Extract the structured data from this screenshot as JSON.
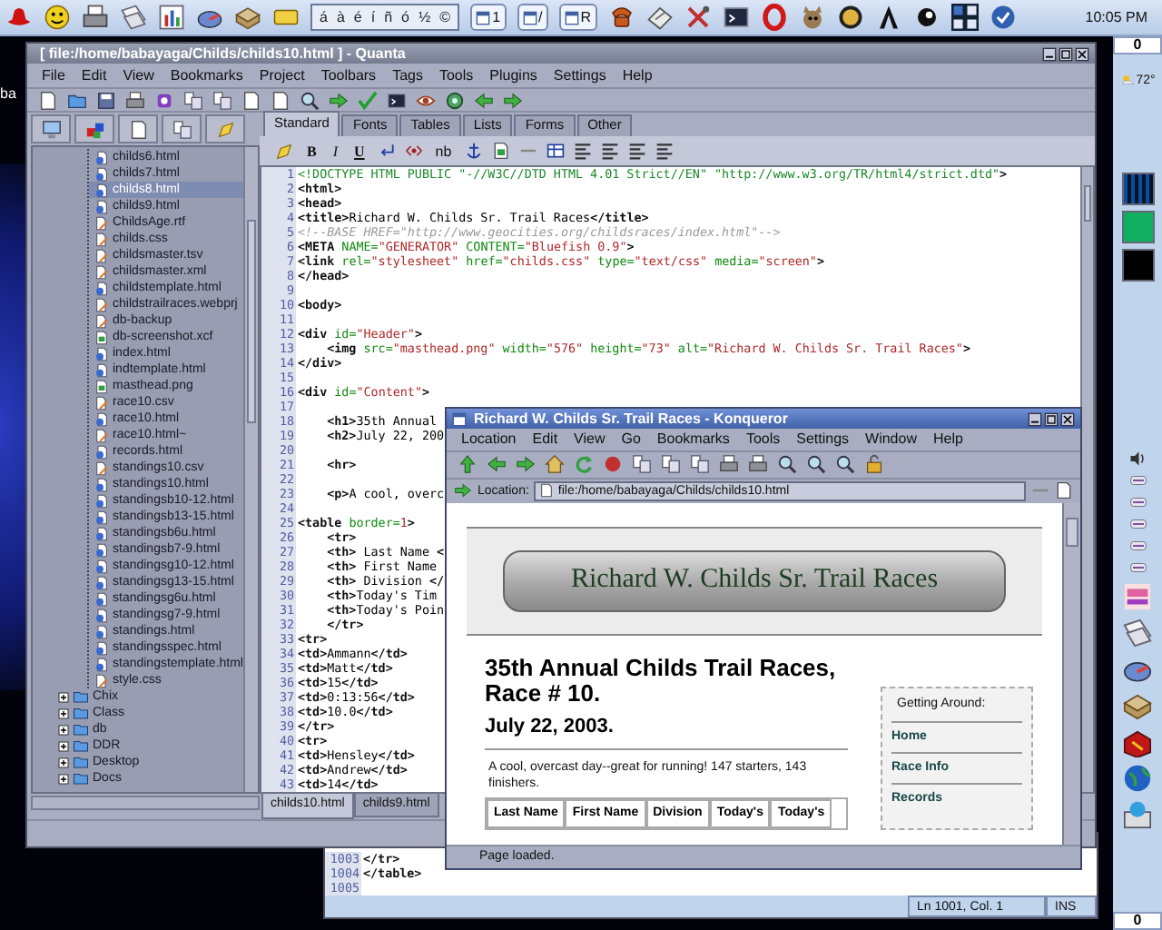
{
  "top_panel": {
    "character_picker": [
      "á",
      "à",
      "é",
      "í",
      "ñ",
      "ó",
      "½",
      "©"
    ],
    "taskbar_buttons": [
      "1",
      "/",
      "R"
    ],
    "clock": "10:05 PM"
  },
  "desktop": {
    "icon_label": "ba"
  },
  "quanta": {
    "title": "[ file:/home/babayaga/Childs/childs10.html ] - Quanta",
    "menu": [
      "File",
      "Edit",
      "View",
      "Bookmarks",
      "Project",
      "Toolbars",
      "Tags",
      "Tools",
      "Plugins",
      "Settings",
      "Help"
    ],
    "file_tree": [
      {
        "children": [
          {
            "label": "childs6.html",
            "kind": "html",
            "selected": false
          },
          {
            "label": "childs7.html",
            "kind": "html",
            "selected": false
          },
          {
            "label": "childs8.html",
            "kind": "html",
            "selected": true
          },
          {
            "label": "childs9.html",
            "kind": "html",
            "selected": false
          },
          {
            "label": "ChildsAge.rtf",
            "kind": "text",
            "selected": false
          },
          {
            "label": "childs.css",
            "kind": "text",
            "selected": false
          },
          {
            "label": "childsmaster.tsv",
            "kind": "text",
            "selected": false
          },
          {
            "label": "childsmaster.xml",
            "kind": "text",
            "selected": false
          },
          {
            "label": "childstemplate.html",
            "kind": "html",
            "selected": false
          },
          {
            "label": "childstrailraces.webprj",
            "kind": "text",
            "selected": false
          },
          {
            "label": "db-backup",
            "kind": "text",
            "selected": false
          },
          {
            "label": "db-screenshot.xcf",
            "kind": "image",
            "selected": false
          },
          {
            "label": "index.html",
            "kind": "html",
            "selected": false
          },
          {
            "label": "indtemplate.html",
            "kind": "html",
            "selected": false
          },
          {
            "label": "masthead.png",
            "kind": "image",
            "selected": false
          },
          {
            "label": "race10.csv",
            "kind": "text",
            "selected": false
          },
          {
            "label": "race10.html",
            "kind": "html",
            "selected": false
          },
          {
            "label": "race10.html~",
            "kind": "text",
            "selected": false
          },
          {
            "label": "records.html",
            "kind": "html",
            "selected": false
          },
          {
            "label": "standings10.csv",
            "kind": "text",
            "selected": false
          },
          {
            "label": "standings10.html",
            "kind": "html",
            "selected": false
          },
          {
            "label": "standingsb10-12.html",
            "kind": "html",
            "selected": false
          },
          {
            "label": "standingsb13-15.html",
            "kind": "html",
            "selected": false
          },
          {
            "label": "standingsb6u.html",
            "kind": "html",
            "selected": false
          },
          {
            "label": "standingsb7-9.html",
            "kind": "html",
            "selected": false
          },
          {
            "label": "standingsg10-12.html",
            "kind": "html",
            "selected": false
          },
          {
            "label": "standingsg13-15.html",
            "kind": "html",
            "selected": false
          },
          {
            "label": "standingsg6u.html",
            "kind": "html",
            "selected": false
          },
          {
            "label": "standingsg7-9.html",
            "kind": "html",
            "selected": false
          },
          {
            "label": "standings.html",
            "kind": "html",
            "selected": false
          },
          {
            "label": "standingsspec.html",
            "kind": "html",
            "selected": false
          },
          {
            "label": "standingstemplate.html",
            "kind": "html",
            "selected": false
          },
          {
            "label": "style.css",
            "kind": "text",
            "selected": false
          }
        ]
      },
      {
        "label": "Chix",
        "kind": "folder",
        "expanded": false,
        "selected": false
      },
      {
        "label": "Class",
        "kind": "folder",
        "expanded": false,
        "selected": false
      },
      {
        "label": "db",
        "kind": "folder",
        "expanded": false,
        "selected": false
      },
      {
        "label": "DDR",
        "kind": "folder",
        "expanded": false,
        "selected": false
      },
      {
        "label": "Desktop",
        "kind": "folder",
        "expanded": false,
        "selected": false
      },
      {
        "label": "Docs",
        "kind": "folder",
        "expanded": false,
        "selected": false
      }
    ],
    "tag_tabs": [
      {
        "label": "Standard",
        "selected": true
      },
      {
        "label": "Fonts",
        "selected": false
      },
      {
        "label": "Tables",
        "selected": false
      },
      {
        "label": "Lists",
        "selected": false
      },
      {
        "label": "Forms",
        "selected": false
      },
      {
        "label": "Other",
        "selected": false
      }
    ],
    "format_buttons": [
      {
        "label": "B",
        "kind": "bold"
      },
      {
        "label": "I",
        "kind": "italic"
      },
      {
        "label": "U",
        "kind": "underline"
      },
      {
        "label": "nb",
        "kind": "plain"
      }
    ],
    "editor": {
      "lines": [
        {
          "number": "1",
          "segments": [
            {
              "kind": "doctype",
              "text": "<!DOCTYPE HTML PUBLIC \"-//W3C//DTD HTML 4.01 Strict//EN\" \"http://www.w3.org/TR/html4/strict.dtd\""
            },
            {
              "kind": "tag",
              "text": ">"
            }
          ]
        },
        {
          "number": "2",
          "segments": [
            {
              "kind": "tag",
              "text": "<html>"
            }
          ]
        },
        {
          "number": "3",
          "segments": [
            {
              "kind": "tag",
              "text": "<head>"
            }
          ]
        },
        {
          "number": "4",
          "segments": [
            {
              "kind": "tag",
              "text": "<title>"
            },
            {
              "kind": "text",
              "text": "Richard W. Childs Sr. Trail Races"
            },
            {
              "kind": "tag",
              "text": "</title>"
            }
          ]
        },
        {
          "number": "5",
          "segments": [
            {
              "kind": "comment",
              "text": "<!--BASE HREF=\"http://www.geocities.org/childsraces/index.html\"-->"
            }
          ]
        },
        {
          "number": "6",
          "segments": [
            {
              "kind": "tag",
              "text": "<META "
            },
            {
              "kind": "attribute",
              "text": "NAME="
            },
            {
              "kind": "value",
              "text": "\"GENERATOR\""
            },
            {
              "kind": "attribute",
              "text": " CONTENT="
            },
            {
              "kind": "value",
              "text": "\"Bluefish 0.9\""
            },
            {
              "kind": "tag",
              "text": ">"
            }
          ]
        },
        {
          "number": "7",
          "segments": [
            {
              "kind": "tag",
              "text": "<link "
            },
            {
              "kind": "attribute",
              "text": "rel="
            },
            {
              "kind": "value",
              "text": "\"stylesheet\""
            },
            {
              "kind": "attribute",
              "text": " href="
            },
            {
              "kind": "value",
              "text": "\"childs.css\""
            },
            {
              "kind": "attribute",
              "text": " type="
            },
            {
              "kind": "value",
              "text": "\"text/css\""
            },
            {
              "kind": "attribute",
              "text": " media="
            },
            {
              "kind": "value",
              "text": "\"screen\""
            },
            {
              "kind": "tag",
              "text": ">"
            }
          ]
        },
        {
          "number": "8",
          "segments": [
            {
              "kind": "tag",
              "text": "</head>"
            }
          ]
        },
        {
          "number": "9"
        },
        {
          "number": "10",
          "segments": [
            {
              "kind": "tag",
              "text": "<body>"
            }
          ]
        },
        {
          "number": "11"
        },
        {
          "number": "12",
          "segments": [
            {
              "kind": "tag",
              "text": "<div "
            },
            {
              "kind": "attribute",
              "text": "id="
            },
            {
              "kind": "value",
              "text": "\"Header\""
            },
            {
              "kind": "tag",
              "text": ">"
            }
          ]
        },
        {
          "number": "13",
          "segments": [
            {
              "kind": "tag",
              "text": "    <img "
            },
            {
              "kind": "attribute",
              "text": "src="
            },
            {
              "kind": "value",
              "text": "\"masthead.png\""
            },
            {
              "kind": "attribute",
              "text": " width="
            },
            {
              "kind": "value",
              "text": "\"576\""
            },
            {
              "kind": "attribute",
              "text": " height="
            },
            {
              "kind": "value",
              "text": "\"73\""
            },
            {
              "kind": "attribute",
              "text": " alt="
            },
            {
              "kind": "value",
              "text": "\"Richard W. Childs Sr. Trail Races\""
            },
            {
              "kind": "tag",
              "text": ">"
            }
          ]
        },
        {
          "number": "14",
          "segments": [
            {
              "kind": "tag",
              "text": "</div>"
            }
          ]
        },
        {
          "number": "15"
        },
        {
          "number": "16",
          "segments": [
            {
              "kind": "tag",
              "text": "<div "
            },
            {
              "kind": "attribute",
              "text": "id="
            },
            {
              "kind": "value",
              "text": "\"Content\""
            },
            {
              "kind": "tag",
              "text": ">"
            }
          ]
        },
        {
          "number": "17"
        },
        {
          "number": "18",
          "segments": [
            {
              "kind": "tag",
              "text": "    <h1>"
            },
            {
              "kind": "text",
              "text": "35th Annual"
            }
          ]
        },
        {
          "number": "19",
          "segments": [
            {
              "kind": "tag",
              "text": "    <h2>"
            },
            {
              "kind": "text",
              "text": "July 22, 200"
            }
          ]
        },
        {
          "number": "20"
        },
        {
          "number": "21",
          "segments": [
            {
              "kind": "tag",
              "text": "    <hr>"
            }
          ]
        },
        {
          "number": "22"
        },
        {
          "number": "23",
          "segments": [
            {
              "kind": "tag",
              "text": "    <p>"
            },
            {
              "kind": "text",
              "text": "A cool, overc"
            }
          ]
        },
        {
          "number": "24"
        },
        {
          "number": "25",
          "segments": [
            {
              "kind": "tag",
              "text": "<table "
            },
            {
              "kind": "attribute",
              "text": "border="
            },
            {
              "kind": "value",
              "text": "1"
            },
            {
              "kind": "tag",
              "text": ">"
            }
          ]
        },
        {
          "number": "26",
          "segments": [
            {
              "kind": "tag",
              "text": "    <tr>"
            }
          ]
        },
        {
          "number": "27",
          "segments": [
            {
              "kind": "tag",
              "text": "    <th>"
            },
            {
              "kind": "text",
              "text": " Last Name "
            },
            {
              "kind": "tag",
              "text": "<"
            }
          ]
        },
        {
          "number": "28",
          "segments": [
            {
              "kind": "tag",
              "text": "    <th>"
            },
            {
              "kind": "text",
              "text": " First Name"
            }
          ]
        },
        {
          "number": "29",
          "segments": [
            {
              "kind": "tag",
              "text": "    <th>"
            },
            {
              "kind": "text",
              "text": " Division "
            },
            {
              "kind": "tag",
              "text": "</"
            }
          ]
        },
        {
          "number": "30",
          "segments": [
            {
              "kind": "tag",
              "text": "    <th>"
            },
            {
              "kind": "text",
              "text": "Today's Tim"
            }
          ]
        },
        {
          "number": "31",
          "segments": [
            {
              "kind": "tag",
              "text": "    <th>"
            },
            {
              "kind": "text",
              "text": "Today's Poin"
            }
          ]
        },
        {
          "number": "32",
          "segments": [
            {
              "kind": "tag",
              "text": "    </tr>"
            }
          ]
        },
        {
          "number": "33",
          "segments": [
            {
              "kind": "tag",
              "text": "<tr>"
            }
          ]
        },
        {
          "number": "34",
          "segments": [
            {
              "kind": "tag",
              "text": "<td>"
            },
            {
              "kind": "text",
              "text": "Ammann"
            },
            {
              "kind": "tag",
              "text": "</td>"
            }
          ]
        },
        {
          "number": "35",
          "segments": [
            {
              "kind": "tag",
              "text": "<td>"
            },
            {
              "kind": "text",
              "text": "Matt"
            },
            {
              "kind": "tag",
              "text": "</td>"
            }
          ]
        },
        {
          "number": "36",
          "segments": [
            {
              "kind": "tag",
              "text": "<td>"
            },
            {
              "kind": "text",
              "text": "15"
            },
            {
              "kind": "tag",
              "text": "</td>"
            }
          ]
        },
        {
          "number": "37",
          "segments": [
            {
              "kind": "tag",
              "text": "<td>"
            },
            {
              "kind": "text",
              "text": "0:13:56"
            },
            {
              "kind": "tag",
              "text": "</td>"
            }
          ]
        },
        {
          "number": "38",
          "segments": [
            {
              "kind": "tag",
              "text": "<td>"
            },
            {
              "kind": "text",
              "text": "10.0"
            },
            {
              "kind": "tag",
              "text": "</td>"
            }
          ]
        },
        {
          "number": "39",
          "segments": [
            {
              "kind": "tag",
              "text": "</tr>"
            }
          ]
        },
        {
          "number": "40",
          "segments": [
            {
              "kind": "tag",
              "text": "<tr>"
            }
          ]
        },
        {
          "number": "41",
          "segments": [
            {
              "kind": "tag",
              "text": "<td>"
            },
            {
              "kind": "text",
              "text": "Hensley"
            },
            {
              "kind": "tag",
              "text": "</td>"
            }
          ]
        },
        {
          "number": "42",
          "segments": [
            {
              "kind": "tag",
              "text": "<td>"
            },
            {
              "kind": "text",
              "text": "Andrew"
            },
            {
              "kind": "tag",
              "text": "</td>"
            }
          ]
        },
        {
          "number": "43",
          "segments": [
            {
              "kind": "tag",
              "text": "<td>"
            },
            {
              "kind": "text",
              "text": "14"
            },
            {
              "kind": "tag",
              "text": "</td>"
            }
          ]
        }
      ]
    },
    "document_tabs": [
      {
        "label": "childs10.html",
        "selected": true
      },
      {
        "label": "childs9.html",
        "selected": false
      }
    ]
  },
  "konqueror": {
    "title": "Richard W. Childs Sr. Trail Races - Konqueror",
    "menu": [
      "Location",
      "Edit",
      "View",
      "Go",
      "Bookmarks",
      "Tools",
      "Settings",
      "Window",
      "Help"
    ],
    "location_label": "Location:",
    "url": "file:/home/babayaga/Childs/childs10.html",
    "page": {
      "banner": "Richard W. Childs Sr. Trail Races",
      "heading": "35th Annual Childs Trail Races, Race # 10.",
      "date": "July 22, 2003.",
      "intro": "A cool, overcast day--great for running! 147 starters, 143 finishers.",
      "table_headers": [
        "Last Name",
        "First Name",
        "Division",
        "Today's",
        "Today's"
      ],
      "sidebar": {
        "title": "Getting Around:",
        "links": [
          "Home",
          "Race Info",
          "Records"
        ]
      }
    },
    "status": "Page loaded."
  },
  "lower_editor": {
    "lines": [
      {
        "number": "1003",
        "segments": [
          {
            "kind": "tag",
            "text": "</tr>"
          }
        ]
      },
      {
        "number": "1004",
        "segments": [
          {
            "kind": "tag",
            "text": "</table>"
          }
        ]
      },
      {
        "number": "1005"
      }
    ],
    "position": "Ln 1001, Col. 1",
    "mode": "INS"
  },
  "right_panel": {
    "top_counter": "0",
    "temperature": "72°",
    "bottom_counter": "0"
  }
}
